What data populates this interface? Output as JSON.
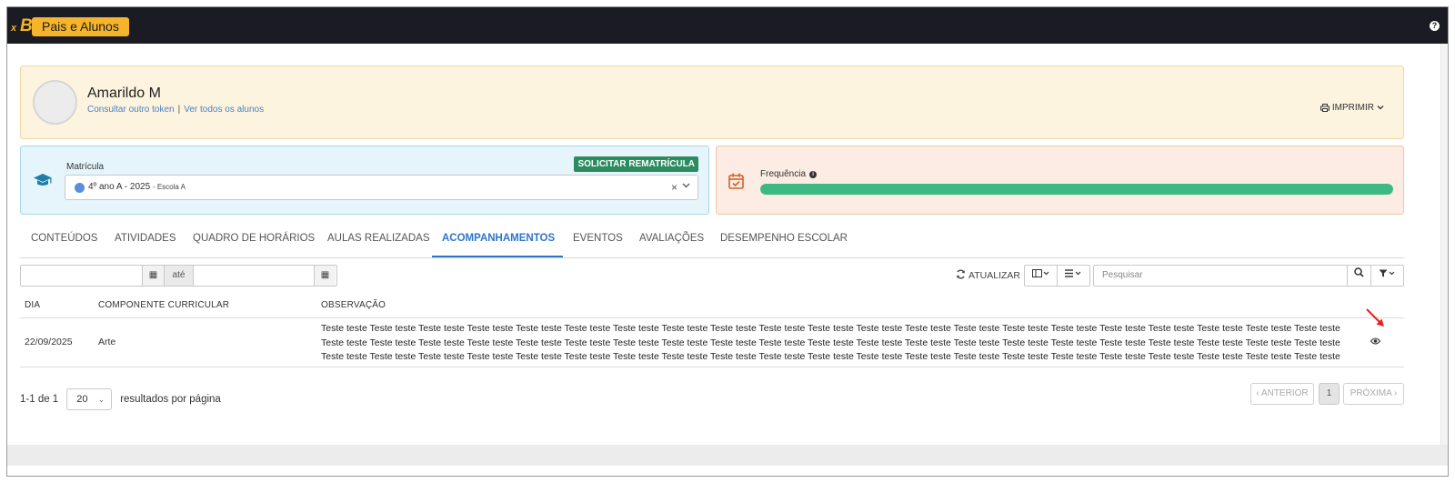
{
  "header": {
    "app_name": "Pais e Alunos",
    "logo_text": "B",
    "logo_prefix": "x",
    "help_label": "?"
  },
  "student": {
    "name": "Amarildo M",
    "link_token": "Consultar outro token",
    "link_separator": "|",
    "link_all": "Ver todos os alunos",
    "print_label": "IMPRIMIR"
  },
  "enrollment": {
    "label": "Matrícula",
    "request_button": "SOLICITAR REMATRÍCULA",
    "selected_class": "4º ano A - 2025",
    "selected_school": "- Escola A",
    "clear_symbol": "×",
    "dot_color": "#5b8ddd"
  },
  "frequency": {
    "label": "Frequência",
    "fill_fraction": 1.0,
    "bar_color": "#3dba83"
  },
  "tabs": [
    {
      "label": "CONTEÚDOS",
      "active": false
    },
    {
      "label": "ATIVIDADES",
      "active": false
    },
    {
      "label": "QUADRO DE HORÁRIOS",
      "active": false
    },
    {
      "label": "AULAS REALIZADAS",
      "active": false
    },
    {
      "label": "ACOMPANHAMENTOS",
      "active": true
    },
    {
      "label": "EVENTOS",
      "active": false
    },
    {
      "label": "AVALIAÇÕES",
      "active": false
    },
    {
      "label": "DESEMPENHO ESCOLAR",
      "active": false
    }
  ],
  "filters": {
    "date_from": "",
    "date_between": "até",
    "date_to": "",
    "refresh_label": "ATUALIZAR",
    "search_placeholder": "Pesquisar"
  },
  "table": {
    "columns": [
      "DIA",
      "COMPONENTE CURRICULAR",
      "OBSERVAÇÃO"
    ],
    "rows": [
      {
        "dia": "22/09/2025",
        "componente": "Arte",
        "observacao": "Teste teste Teste teste Teste teste Teste teste Teste teste Teste teste Teste teste Teste teste Teste teste Teste teste Teste teste Teste teste Teste teste Teste teste Teste teste Teste teste Teste teste Teste teste Teste teste Teste teste Teste teste Teste teste Teste teste Teste teste Teste teste Teste teste Teste teste Teste teste Teste teste Teste teste Teste teste Teste teste Teste teste Teste teste Teste teste Teste teste Teste teste Teste teste Teste teste Teste teste Teste teste Teste teste Teste teste Teste teste Teste teste Teste teste Teste teste Teste teste Teste teste Teste teste Teste teste Teste teste Teste teste Teste teste Teste teste Teste teste Teste teste Teste teste Teste teste Teste teste Teste teste Teste teste Teste teste Teste teste Teste teste..."
      }
    ]
  },
  "pagination": {
    "range_text": "1-1 de 1",
    "per_page_value": "20",
    "per_page_label": "resultados por página",
    "prev_label": "‹ ANTERIOR",
    "current_page": "1",
    "next_label": "PRÓXIMA ›"
  }
}
